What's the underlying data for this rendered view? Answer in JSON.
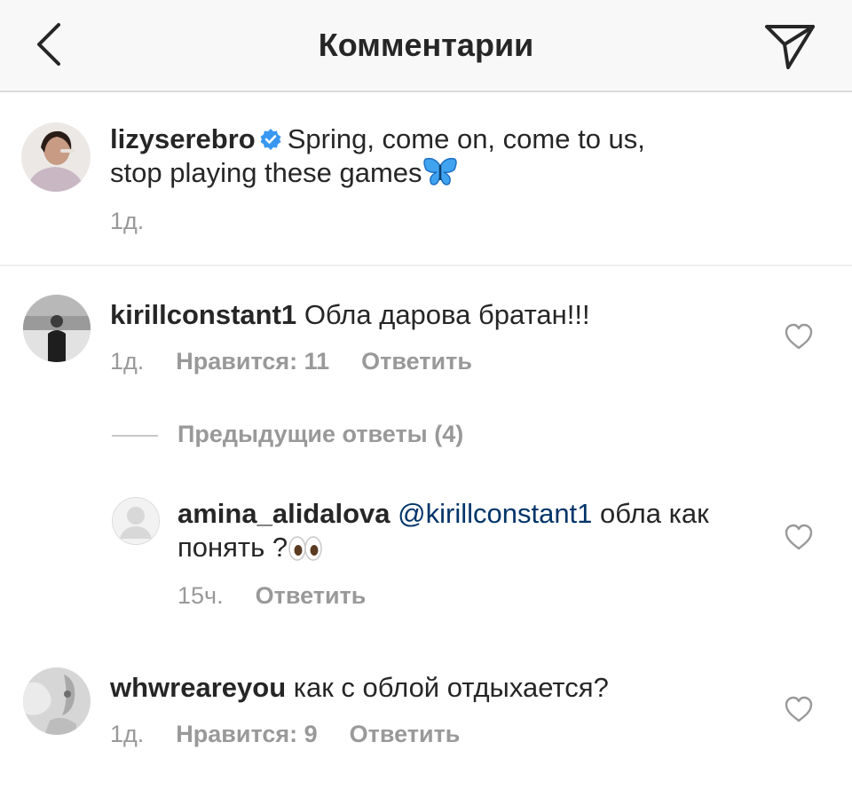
{
  "header": {
    "title": "Комментарии",
    "back_icon": "chevron-left-icon",
    "send_icon": "paper-plane-icon"
  },
  "caption": {
    "username": "lizyserebro",
    "verified": true,
    "text": "Spring, come on, come to us,",
    "text_line2": "stop playing these games",
    "emoji": "butterfly",
    "time": "1д."
  },
  "comments": [
    {
      "username": "kirillconstant1",
      "text": "Обла дарова братан!!!",
      "time": "1д.",
      "likes": "Нравится: 11",
      "reply": "Ответить"
    },
    {
      "username": "whwreareyou",
      "text": "как с облой отдыхается?",
      "time": "1д.",
      "likes": "Нравится: 9",
      "reply": "Ответить"
    }
  ],
  "previous_replies": "Предыдущие ответы (4)",
  "reply": {
    "username": "amina_alidalova",
    "mention": "@kirillconstant1",
    "text": "обла как",
    "text_line2": "понять ?",
    "emoji": "eyes",
    "time": "15ч.",
    "reply": "Ответить"
  },
  "colors": {
    "header_bg": "#f8f8f8",
    "text": "#262626",
    "muted": "#999999",
    "mention": "#003569",
    "verified": "#3897f0"
  }
}
